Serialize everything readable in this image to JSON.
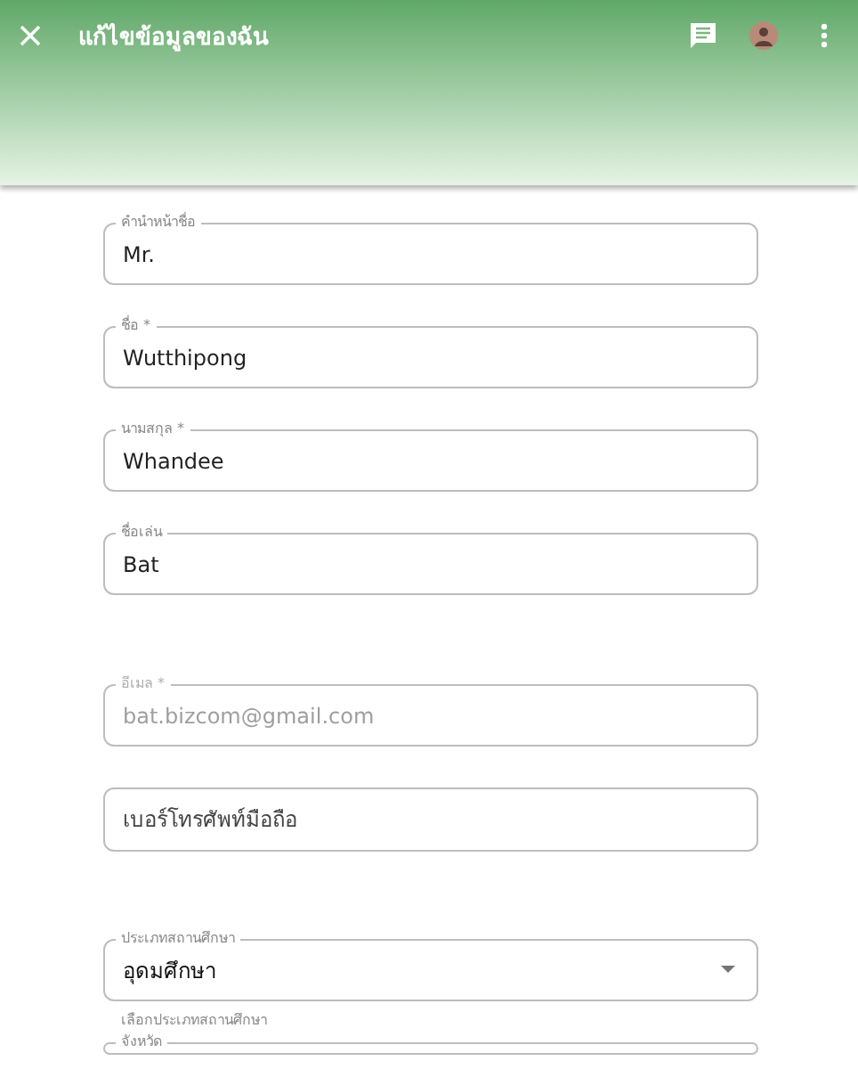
{
  "header": {
    "title": "แก้ไขข้อมูลของฉัน"
  },
  "sections": [
    {
      "fields": [
        {
          "kind": "text",
          "label": "คำนำหน้าชื่อ",
          "value": "Mr.",
          "disabled": false
        },
        {
          "kind": "text",
          "label": "ชื่อ *",
          "value": "Wutthipong",
          "disabled": false
        },
        {
          "kind": "text",
          "label": "นามสกุล *",
          "value": "Whandee",
          "disabled": false
        },
        {
          "kind": "text",
          "label": "ชื่อเล่น",
          "value": "Bat",
          "disabled": false
        }
      ]
    },
    {
      "fields": [
        {
          "kind": "text",
          "label": "อีเมล *",
          "value": "bat.bizcom@gmail.com",
          "disabled": true
        },
        {
          "kind": "text",
          "placeholder": "เบอร์โทรศัพท์มือถือ",
          "disabled": false
        }
      ]
    },
    {
      "fields": [
        {
          "kind": "select",
          "label": "ประเภทสถานศึกษา",
          "value": "อุดมศึกษา",
          "hint": "เลือกประเภทสถานศึกษา",
          "disabled": false
        },
        {
          "kind": "text",
          "label": "จังหวัด",
          "disabled": false
        }
      ]
    }
  ]
}
